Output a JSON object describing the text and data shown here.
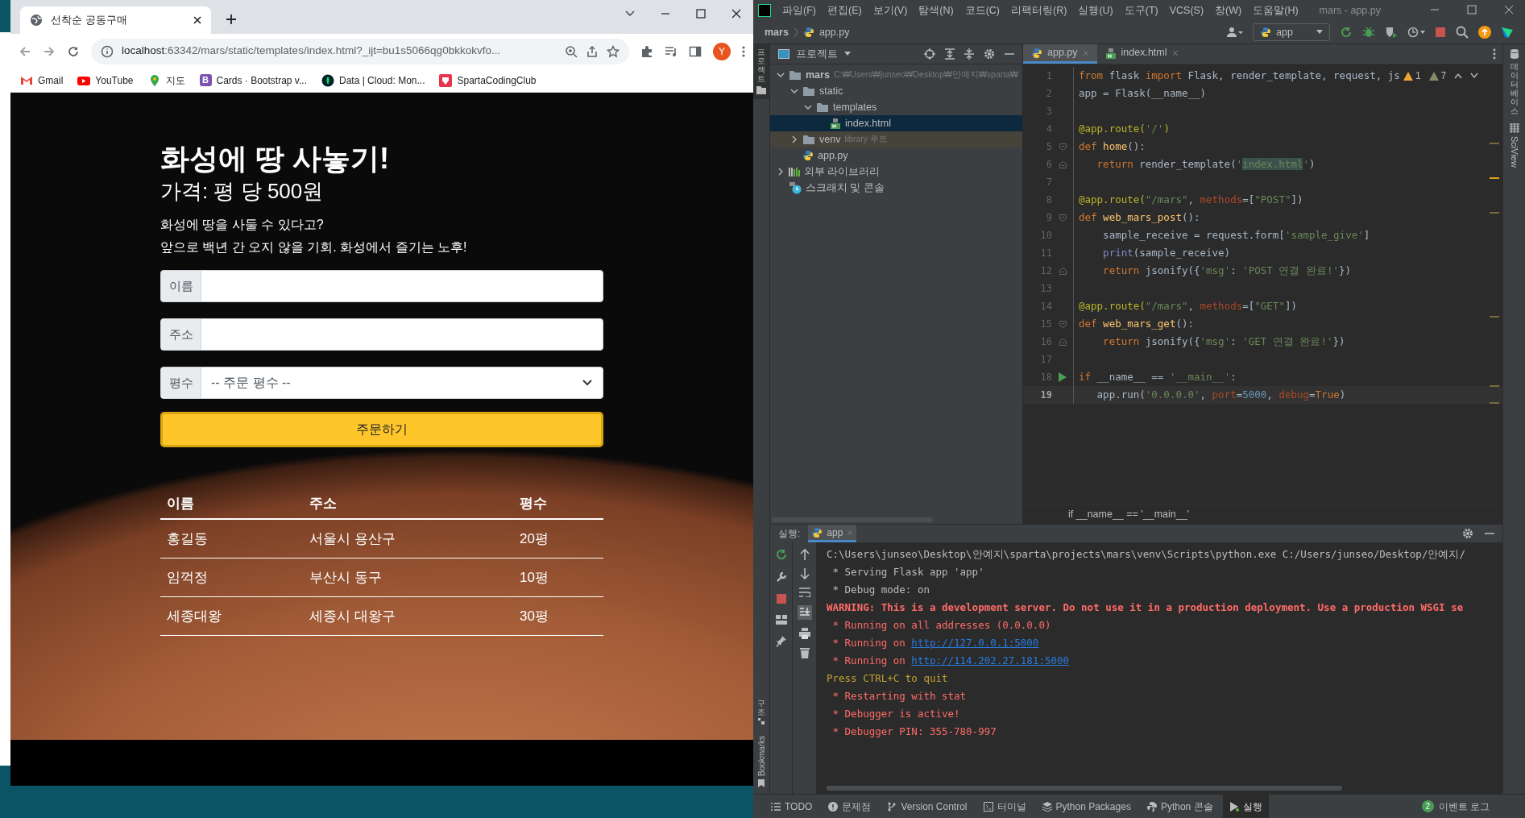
{
  "browser": {
    "tab": {
      "title": "선착순 공동구매"
    },
    "url": {
      "host": "localhost",
      "rest": ":63342/mars/static/templates/index.html?_ijt=bu1s5066qg0bkkokvfo..."
    },
    "profile_initial": "Y",
    "bookmarks": [
      {
        "kind": "gmail",
        "label": "Gmail"
      },
      {
        "kind": "youtube",
        "label": "YouTube"
      },
      {
        "kind": "maps",
        "label": "지도"
      },
      {
        "kind": "bootstrap",
        "logo_letter": "B",
        "label": "Cards · Bootstrap v..."
      },
      {
        "kind": "leaf",
        "label": "Data | Cloud: Mon..."
      },
      {
        "kind": "sparta",
        "label": "SpartaCodingClub"
      }
    ]
  },
  "page": {
    "title": "화성에 땅 사놓기!",
    "price": "가격: 평 당 500원",
    "description": [
      "화성에 땅을 사둘 수 있다고?",
      "앞으로 백년 간 오지 않을 기회. 화성에서 즐기는 노후!"
    ],
    "fields": [
      {
        "kind": "input",
        "label": "이름"
      },
      {
        "kind": "input",
        "label": "주소"
      },
      {
        "kind": "select",
        "label": "평수",
        "value": "-- 주문 평수 --"
      }
    ],
    "order_button": "주문하기",
    "table": {
      "columns": [
        "이름",
        "주소",
        "평수"
      ],
      "rows": [
        [
          "홍길동",
          "서울시 용산구",
          "20평"
        ],
        [
          "임꺽정",
          "부산시 동구",
          "10평"
        ],
        [
          "세종대왕",
          "세종시 대왕구",
          "30평"
        ]
      ]
    }
  },
  "ide": {
    "menu": [
      "파일(F)",
      "편집(E)",
      "보기(V)",
      "탐색(N)",
      "코드(C)",
      "리팩터링(R)",
      "실행(U)",
      "도구(T)",
      "VCS(S)",
      "창(W)",
      "도움말(H)"
    ],
    "window_title": "mars - app.py",
    "breadcrumb": [
      "mars",
      "app.py"
    ],
    "run_config": "app",
    "left_stripe": "프로젝트",
    "project_panel": {
      "title": "프로젝트",
      "tree": [
        {
          "kind": "folder",
          "label": "mars",
          "hint": "C:₩Users₩junseo₩Desktop₩안예지₩sparta₩",
          "expanded": true,
          "selected": false,
          "children": [
            {
              "kind": "folder",
              "label": "static",
              "expanded": true,
              "selected": false,
              "children": [
                {
                  "kind": "folder",
                  "label": "templates",
                  "expanded": true,
                  "selected": false,
                  "children": [
                    {
                      "kind": "html",
                      "label": "index.html",
                      "selected": true
                    }
                  ]
                }
              ]
            },
            {
              "kind": "library-folder",
              "label": "venv",
              "hint": "library 루트",
              "expanded": false,
              "selected": false
            },
            {
              "kind": "python",
              "label": "app.py",
              "selected": false
            }
          ]
        },
        {
          "kind": "library",
          "label": "외부 라이브러리",
          "expanded": false,
          "selected": false
        },
        {
          "kind": "scratch",
          "label": "스크래치 및 콘솔",
          "selected": false
        }
      ]
    },
    "editor": {
      "tabs": [
        {
          "kind": "python",
          "label": "app.py",
          "selected": true
        },
        {
          "kind": "html",
          "label": "index.html",
          "selected": false
        }
      ],
      "warnings": "1",
      "weak_warnings": "7",
      "lines": [
        {
          "number": "1",
          "current": false,
          "tokens": [
            {
              "kind": "kw",
              "text": "from"
            },
            {
              "kind": "txt",
              "text": " flask "
            },
            {
              "kind": "kw",
              "text": "import"
            },
            {
              "kind": "txt",
              "text": " Flask, render_template, request, js"
            }
          ]
        },
        {
          "number": "2",
          "current": false,
          "tokens": [
            {
              "kind": "txt",
              "text": "app = Flask(__name__)"
            }
          ]
        },
        {
          "number": "3",
          "current": false
        },
        {
          "number": "4",
          "current": false,
          "tokens": [
            {
              "kind": "dec",
              "text": "@app.route("
            },
            {
              "kind": "str",
              "text": "'/'"
            },
            {
              "kind": "dec",
              "text": ")"
            }
          ]
        },
        {
          "number": "5",
          "current": false,
          "kind": "fold",
          "tokens": [
            {
              "kind": "kw",
              "text": "def "
            },
            {
              "kind": "fn",
              "text": "home"
            },
            {
              "kind": "txt",
              "text": "():"
            }
          ]
        },
        {
          "number": "6",
          "current": false,
          "kind": "fold-end",
          "tokens": [
            {
              "kind": "kw",
              "text": "   return"
            },
            {
              "kind": "txt",
              "text": " render_template("
            },
            {
              "kind": "str",
              "text": "'"
            },
            {
              "kind": "strhl",
              "text": "index.html"
            },
            {
              "kind": "str",
              "text": "'"
            },
            {
              "kind": "txt",
              "text": ")"
            }
          ]
        },
        {
          "number": "7",
          "current": false
        },
        {
          "number": "8",
          "current": false,
          "tokens": [
            {
              "kind": "dec",
              "text": "@app.route("
            },
            {
              "kind": "str",
              "text": "\"/mars\""
            },
            {
              "kind": "txt",
              "text": ", "
            },
            {
              "kind": "kwarg",
              "text": "methods"
            },
            {
              "kind": "txt",
              "text": "=["
            },
            {
              "kind": "str",
              "text": "\"POST\""
            },
            {
              "kind": "txt",
              "text": "])"
            }
          ]
        },
        {
          "number": "9",
          "current": false,
          "kind": "fold",
          "tokens": [
            {
              "kind": "kw",
              "text": "def "
            },
            {
              "kind": "fn",
              "text": "web_mars_post"
            },
            {
              "kind": "txt",
              "text": "():"
            }
          ]
        },
        {
          "number": "10",
          "current": false,
          "tokens": [
            {
              "kind": "txt",
              "text": "    sample_receive = request.form["
            },
            {
              "kind": "str",
              "text": "'sample_give'"
            },
            {
              "kind": "txt",
              "text": "]"
            }
          ]
        },
        {
          "number": "11",
          "current": false,
          "tokens": [
            {
              "kind": "builtin",
              "text": "    print"
            },
            {
              "kind": "txt",
              "text": "(sample_receive)"
            }
          ]
        },
        {
          "number": "12",
          "current": false,
          "kind": "fold-end",
          "tokens": [
            {
              "kind": "kw",
              "text": "    return"
            },
            {
              "kind": "txt",
              "text": " jsonify({"
            },
            {
              "kind": "str",
              "text": "'msg'"
            },
            {
              "kind": "txt",
              "text": ": "
            },
            {
              "kind": "str",
              "text": "'POST 연결 완료!'"
            },
            {
              "kind": "txt",
              "text": "})"
            }
          ]
        },
        {
          "number": "13",
          "current": false
        },
        {
          "number": "14",
          "current": false,
          "tokens": [
            {
              "kind": "dec",
              "text": "@app.route("
            },
            {
              "kind": "str",
              "text": "\"/mars\""
            },
            {
              "kind": "txt",
              "text": ", "
            },
            {
              "kind": "kwarg",
              "text": "methods"
            },
            {
              "kind": "txt",
              "text": "=["
            },
            {
              "kind": "str",
              "text": "\"GET\""
            },
            {
              "kind": "txt",
              "text": "])"
            }
          ]
        },
        {
          "number": "15",
          "current": false,
          "kind": "fold",
          "tokens": [
            {
              "kind": "kw",
              "text": "def "
            },
            {
              "kind": "fn",
              "text": "web_mars_get"
            },
            {
              "kind": "txt",
              "text": "():"
            }
          ]
        },
        {
          "number": "16",
          "current": false,
          "kind": "fold-end",
          "tokens": [
            {
              "kind": "kw",
              "text": "    return"
            },
            {
              "kind": "txt",
              "text": " jsonify({"
            },
            {
              "kind": "str",
              "text": "'msg'"
            },
            {
              "kind": "txt",
              "text": ": "
            },
            {
              "kind": "str",
              "text": "'GET 연결 완료!'"
            },
            {
              "kind": "txt",
              "text": "})"
            }
          ]
        },
        {
          "number": "17",
          "current": false
        },
        {
          "number": "18",
          "current": false,
          "kind": "run",
          "tokens": [
            {
              "kind": "kw",
              "text": "if"
            },
            {
              "kind": "txt",
              "text": " __name__ == "
            },
            {
              "kind": "str",
              "text": "'__main__'"
            },
            {
              "kind": "txt",
              "text": ":"
            }
          ]
        },
        {
          "number": "19",
          "current": true,
          "tokens": [
            {
              "kind": "txt",
              "text": "   app.run("
            },
            {
              "kind": "str",
              "text": "'0.0.0.0'"
            },
            {
              "kind": "txt",
              "text": ", "
            },
            {
              "kind": "kwarg",
              "text": "port"
            },
            {
              "kind": "txt",
              "text": "="
            },
            {
              "kind": "num",
              "text": "5000"
            },
            {
              "kind": "txt",
              "text": ", "
            },
            {
              "kind": "kwarg",
              "text": "debug"
            },
            {
              "kind": "txt",
              "text": "="
            },
            {
              "kind": "kw",
              "text": "True"
            },
            {
              "kind": "txt",
              "text": ")"
            }
          ]
        }
      ],
      "breadcrumb": "if __name__ == '__main__'"
    },
    "right_stripe": [
      {
        "kind": "database",
        "label": "데이터베이스"
      },
      {
        "kind": "sciview",
        "label": "SciView"
      }
    ],
    "bottom_left_stripe": [
      {
        "kind": "structure",
        "label": "구조"
      },
      {
        "kind": "bookmarks",
        "label": "Bookmarks"
      }
    ],
    "run_panel": {
      "label": "실행:",
      "tab": "app",
      "lines": [
        {
          "segments": [
            {
              "kind": "plain",
              "text": "C:\\Users\\junseo\\Desktop\\안예지\\sparta\\projects\\mars\\venv\\Scripts\\python.exe C:/Users/junseo/Desktop/안예지/"
            }
          ]
        },
        {
          "segments": [
            {
              "kind": "plain",
              "text": " * Serving Flask app 'app'"
            }
          ]
        },
        {
          "segments": [
            {
              "kind": "plain",
              "text": " * Debug mode: on"
            }
          ]
        },
        {
          "segments": [
            {
              "kind": "warn",
              "text": "WARNING: This is a development server. Do not use it in a production deployment. Use a production WSGI se"
            }
          ]
        },
        {
          "segments": [
            {
              "kind": "err",
              "text": " * Running on all addresses (0.0.0.0)"
            }
          ]
        },
        {
          "segments": [
            {
              "kind": "err",
              "text": " * Running on "
            },
            {
              "kind": "link",
              "text": "http://127.0.0.1:5000"
            }
          ]
        },
        {
          "segments": [
            {
              "kind": "err",
              "text": " * Running on "
            },
            {
              "kind": "link",
              "text": "http://114.202.27.181:5000"
            }
          ]
        },
        {
          "segments": [
            {
              "kind": "note",
              "text": "Press CTRL+C to quit"
            }
          ]
        },
        {
          "segments": [
            {
              "kind": "err",
              "text": " * Restarting with stat"
            }
          ]
        },
        {
          "segments": [
            {
              "kind": "err",
              "text": " * Debugger is active!"
            }
          ]
        },
        {
          "segments": [
            {
              "kind": "err",
              "text": " * Debugger PIN: 355-780-997"
            }
          ]
        }
      ]
    },
    "status_tabs": [
      {
        "kind": "list",
        "label": "TODO",
        "selected": false
      },
      {
        "kind": "problems",
        "label": "문제점",
        "selected": false
      },
      {
        "kind": "vcs",
        "label": "Version Control",
        "selected": false
      },
      {
        "kind": "terminal",
        "label": "터미널",
        "selected": false
      },
      {
        "kind": "packages",
        "label": "Python Packages",
        "selected": false
      },
      {
        "kind": "python",
        "label": "Python 콘솔",
        "selected": false
      },
      {
        "kind": "run",
        "label": "실행",
        "selected": true
      }
    ],
    "event_log": {
      "count": "2",
      "label": "이벤트 로그"
    }
  }
}
